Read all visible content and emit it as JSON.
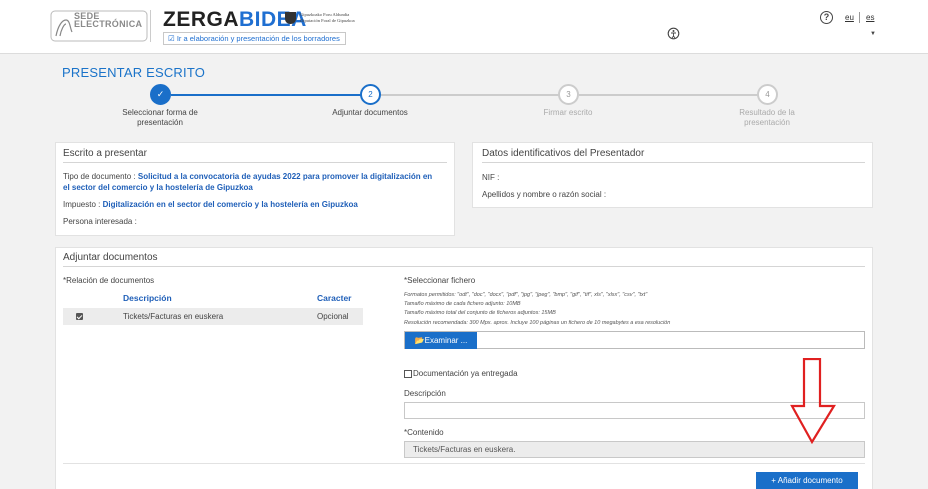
{
  "header": {
    "sede_line1": "SEDE",
    "sede_line2": "ELECTRÓNICA",
    "zerga_part1": "ZERGA",
    "zerga_part2": "BIDEA",
    "foral_line1": "Gipuzkoako Foru Aldundia",
    "foral_line2": "Diputación Foral de Gipuzkoa",
    "draft_link": "Ir a elaboración y presentación de los borradores",
    "help": "?",
    "lang_eu": "eu",
    "lang_es": "es",
    "chevron": "▼"
  },
  "page": {
    "title": "PRESENTAR ESCRITO"
  },
  "stepper": {
    "steps": [
      {
        "number": "✓",
        "label": "Seleccionar forma de presentación",
        "state": "done"
      },
      {
        "number": "2",
        "label": "Adjuntar documentos",
        "state": "active"
      },
      {
        "number": "3",
        "label": "Firmar escrito",
        "state": "pending"
      },
      {
        "number": "4",
        "label": "Resultado de la presentación",
        "state": "pending"
      }
    ]
  },
  "escrito": {
    "title": "Escrito a presentar",
    "tipo_label": "Tipo de documento :",
    "tipo_value_line1": "Solicitud a la convocatoria de ayudas 2022 para promover la digitalización en",
    "tipo_value_line2": "el sector del comercio y la hostelería de Gipuzkoa",
    "impuesto_label": "Impuesto :",
    "impuesto_value": "Digitalización en el sector del comercio y la hostelería en Gipuzkoa",
    "persona_label": "Persona interesada :"
  },
  "presentador": {
    "title": "Datos identificativos del Presentador",
    "nif_label": "NIF :",
    "nombre_label": "Apellidos y nombre o razón social :"
  },
  "adjuntar": {
    "title": "Adjuntar documentos",
    "relacion_label": "*Relación de documentos",
    "col_descripcion": "Descripción",
    "col_caracter": "Caracter",
    "rows": [
      {
        "descripcion": "Tickets/Facturas en euskera",
        "caracter": "Opcional"
      }
    ],
    "seleccionar_label": "*Seleccionar fichero",
    "formatos": "Formatos permitidos: \"odt\", \"doc\", \"docx\", \"pdf\", \"jpg\", \"jpeg\", \"bmp\", \"gif\", \"tif\", xls\", \"xlsx\", \"csv\", \"txt\"",
    "tam_cada": "Tamaño máximo de cada fichero adjunto: 10MB",
    "tam_total": "Tamaño máximo total del conjunto de ficheros adjuntos: 15MB",
    "resolucion": "Resolución recomendada: 300 Mpx. aprox. Incluye 100 páginas un fichero de 10 megabytes a esa resolución",
    "examinar": "Examinar ...",
    "ya_entregada": "Documentación ya entregada",
    "descripcion_label": "Descripción",
    "descripcion_value": "",
    "contenido_label": "*Contenido",
    "contenido_value": "Tickets/Facturas en euskera.",
    "anadir": "+   Añadir documento"
  },
  "colors": {
    "accent": "#1a6fc9",
    "arrow": "#e02020"
  }
}
